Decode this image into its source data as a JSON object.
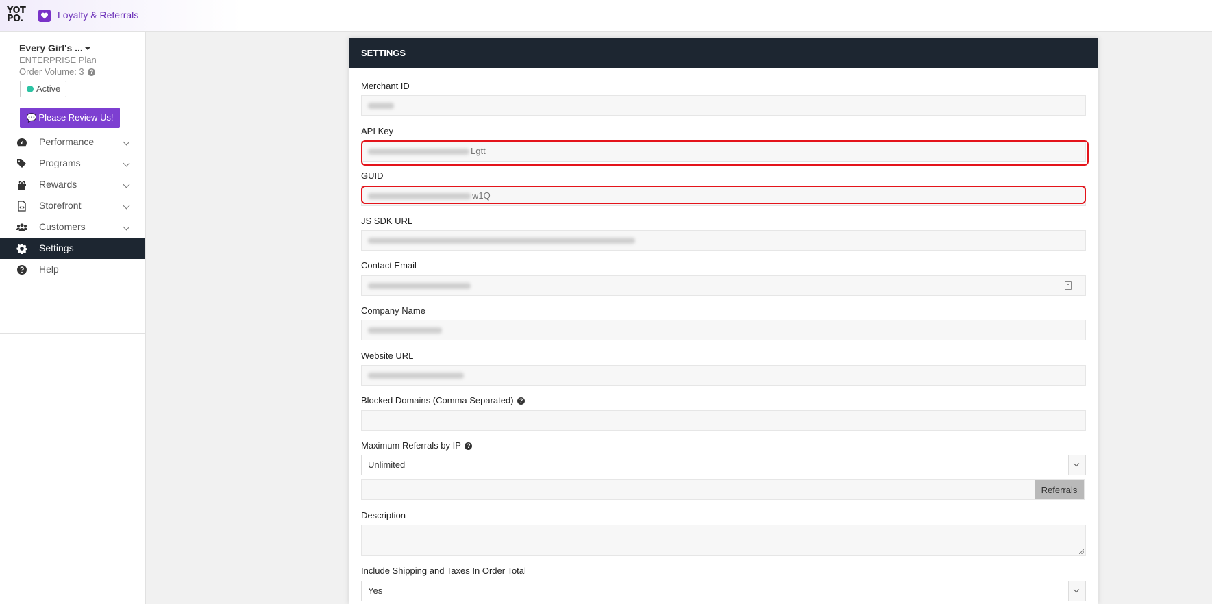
{
  "app": {
    "logo_text": "YOT PO.",
    "title": "Loyalty & Referrals"
  },
  "account": {
    "name": "Every Girl's ...",
    "plan": "ENTERPRISE Plan",
    "order_volume": "Order Volume: 3",
    "status": "Active",
    "review_button": "Please Review Us!"
  },
  "nav": {
    "items": [
      {
        "label": "Performance",
        "icon": "dashboard-icon",
        "expandable": true
      },
      {
        "label": "Programs",
        "icon": "tags-icon",
        "expandable": true
      },
      {
        "label": "Rewards",
        "icon": "gift-icon",
        "expandable": true
      },
      {
        "label": "Storefront",
        "icon": "code-file-icon",
        "expandable": true
      },
      {
        "label": "Customers",
        "icon": "users-icon",
        "expandable": true
      },
      {
        "label": "Settings",
        "icon": "gear-icon",
        "expandable": false,
        "active": true
      },
      {
        "label": "Help",
        "icon": "question-circle-icon",
        "expandable": false
      }
    ]
  },
  "settings": {
    "header": "SETTINGS",
    "merchant_id_label": "Merchant ID",
    "api_key_label": "API Key",
    "api_key_visible_suffix": "Lgtt",
    "guid_label": "GUID",
    "guid_visible_suffix": "w1Q",
    "js_sdk_url_label": "JS SDK URL",
    "contact_email_label": "Contact Email",
    "company_name_label": "Company Name",
    "website_url_label": "Website URL",
    "blocked_domains_label": "Blocked Domains (Comma Separated)",
    "max_referrals_label": "Maximum Referrals by IP",
    "max_referrals_value": "Unlimited",
    "referrals_addon": "Referrals",
    "description_label": "Description",
    "include_shipping_label": "Include Shipping and Taxes In Order Total",
    "include_shipping_value": "Yes"
  },
  "colors": {
    "accent_purple": "#7d3fd1",
    "header_dark": "#1d2631",
    "highlight_red": "#e4141b",
    "active_green": "#2cc3a3"
  }
}
